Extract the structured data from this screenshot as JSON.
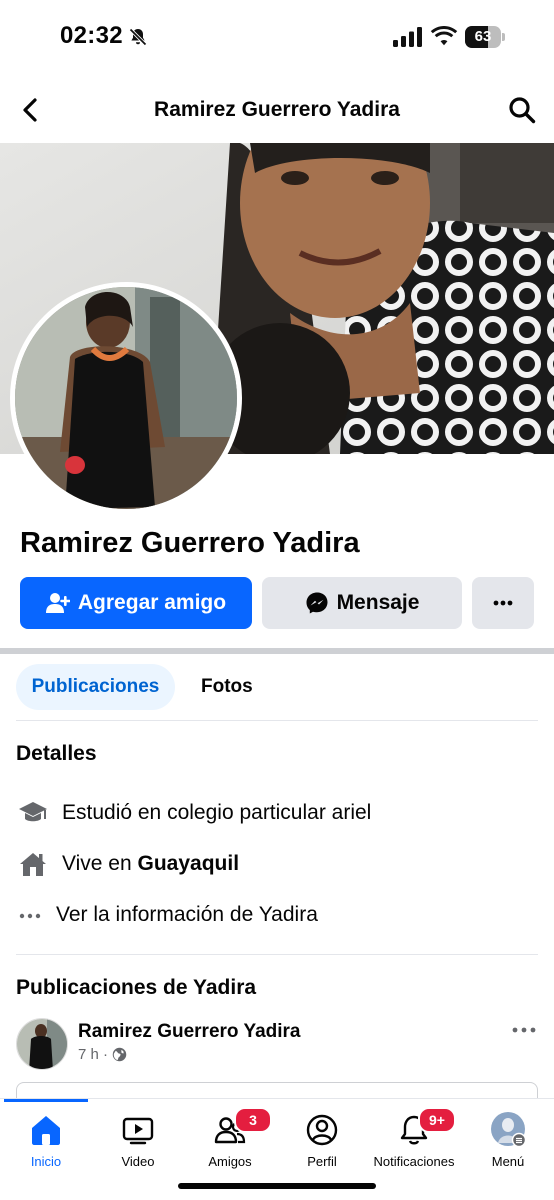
{
  "status_bar": {
    "time": "02:32",
    "battery": "63",
    "battery_level": 0.63,
    "icons": [
      "bell-slash-icon",
      "cellular-signal-icon",
      "wifi-icon",
      "battery-icon"
    ]
  },
  "header": {
    "title": "Ramirez Guerrero Yadira",
    "back_icon": "chevron-left-icon",
    "search_icon": "search-icon"
  },
  "profile": {
    "name": "Ramirez Guerrero Yadira",
    "add_friend_label": "Agregar amigo",
    "message_label": "Mensaje",
    "more_icon": "more-dots-icon"
  },
  "tabs": [
    {
      "label": "Publicaciones",
      "active": true
    },
    {
      "label": "Fotos",
      "active": false
    }
  ],
  "details": {
    "title": "Detalles",
    "education": "Estudió en colegio particular ariel",
    "lives_prefix": "Vive en ",
    "lives_city": "Guayaquil",
    "see_info": "Ver la información de Yadira"
  },
  "posts": {
    "title": "Publicaciones de Yadira",
    "author": "Ramirez Guerrero Yadira",
    "time": "7 h ·",
    "audience_icon": "globe-icon"
  },
  "bottom_nav": [
    {
      "label": "Inicio",
      "icon": "home-icon",
      "active": true,
      "badge": ""
    },
    {
      "label": "Video",
      "icon": "video-icon",
      "active": false,
      "badge": ""
    },
    {
      "label": "Amigos",
      "icon": "friends-icon",
      "active": false,
      "badge": "3"
    },
    {
      "label": "Perfil",
      "icon": "profile-icon",
      "active": false,
      "badge": ""
    },
    {
      "label": "Notificaciones",
      "icon": "bell-icon",
      "active": false,
      "badge": "9+"
    },
    {
      "label": "Menú",
      "icon": "menu-avatar-icon",
      "active": false,
      "badge": ""
    }
  ],
  "colors": {
    "accent": "#0866ff",
    "badge": "#e41e3f",
    "tab_active_bg": "#ebf5ff",
    "secondary_button": "#e4e6eb"
  }
}
